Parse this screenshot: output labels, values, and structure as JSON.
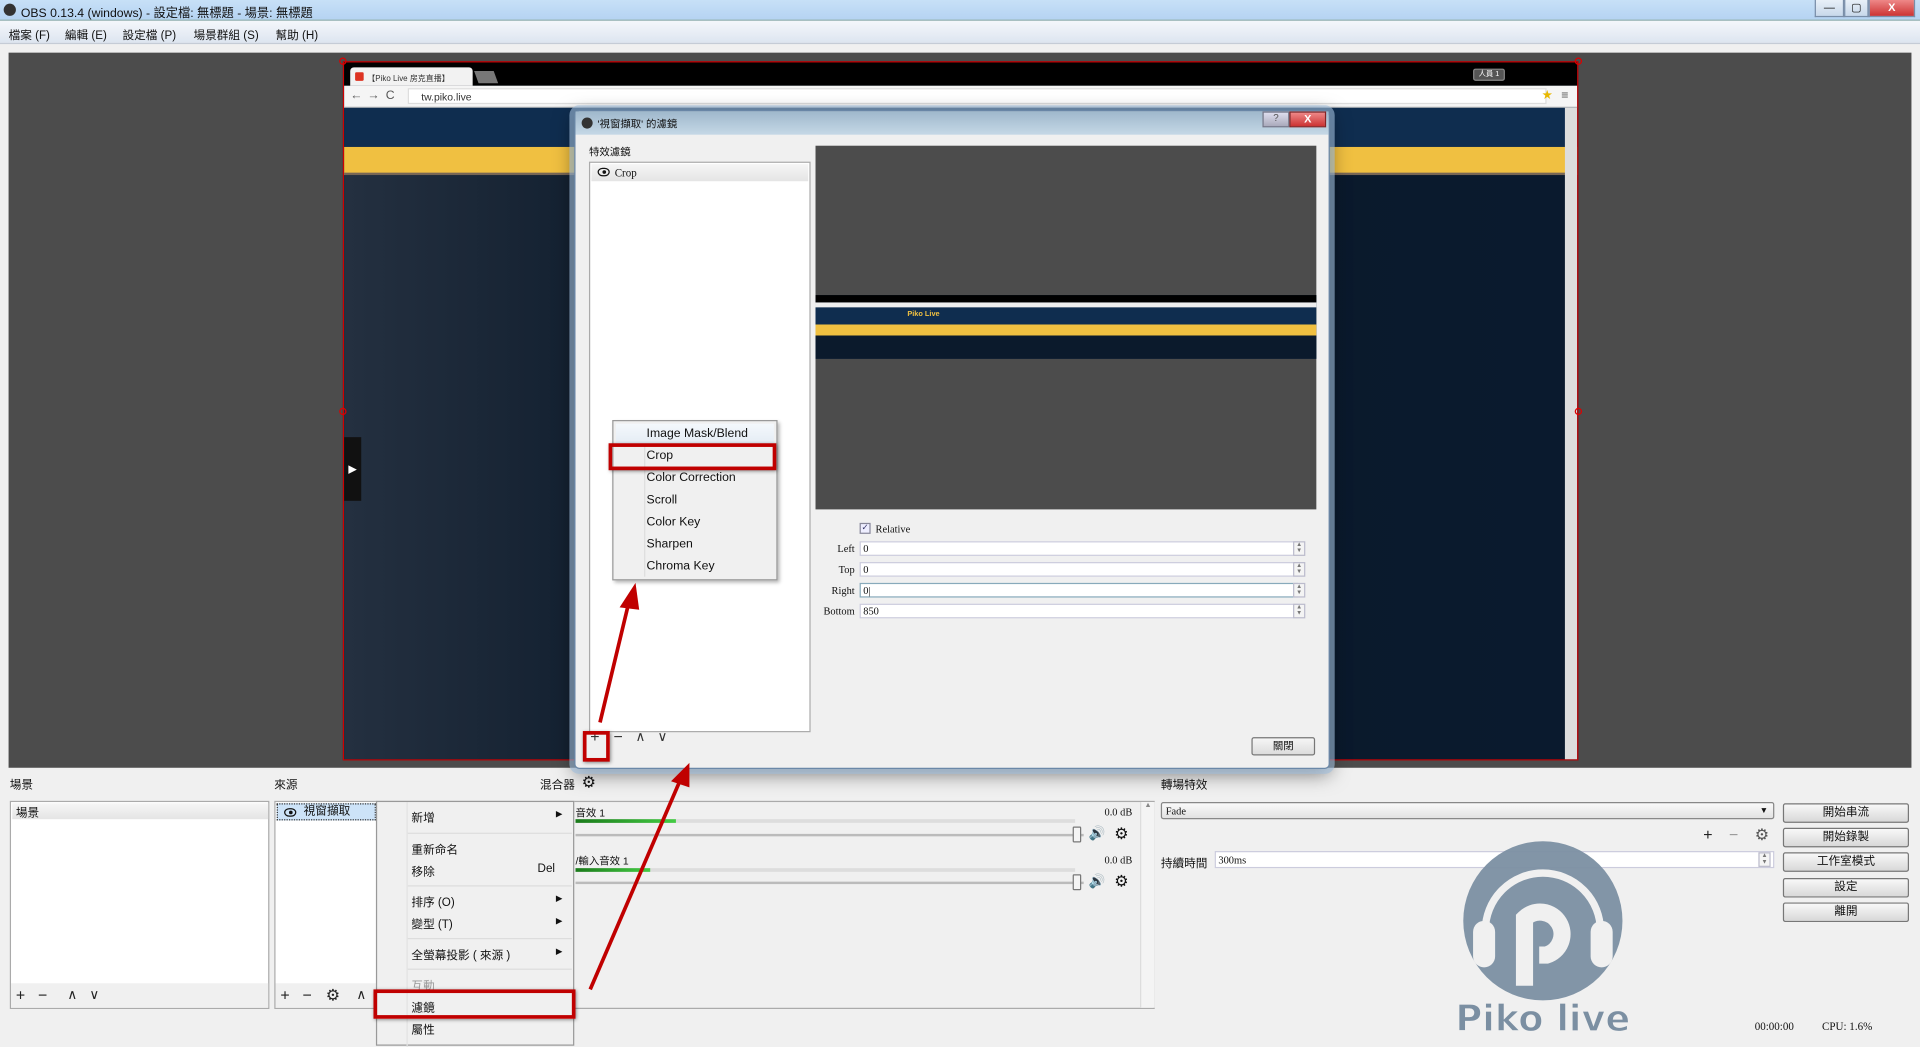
{
  "window": {
    "title": "OBS 0.13.4 (windows) - 設定檔: 無標題 - 場景: 無標題",
    "minimize": "—",
    "maximize": "▢",
    "close": "X"
  },
  "menubar": [
    "檔案 (F)",
    "編輯 (E)",
    "設定檔 (P)",
    "場景群組 (S)",
    "幫助 (H)"
  ],
  "browser": {
    "tab_title": "【Piko Live 房克直播】",
    "url": "tw.piko.live",
    "user_badge": "人員 1",
    "mini_logo": "Piko Live"
  },
  "filters_dialog": {
    "title": "'視窗擷取' 的濾鏡",
    "section_label": "特效濾鏡",
    "filters": [
      "Crop"
    ],
    "relative_label": "Relative",
    "relative_checked": true,
    "fields": [
      {
        "label": "Left",
        "value": "0"
      },
      {
        "label": "Top",
        "value": "0"
      },
      {
        "label": "Right",
        "value": "0|"
      },
      {
        "label": "Bottom",
        "value": "850"
      }
    ],
    "close_button": "關閉",
    "help": "?",
    "x": "X"
  },
  "add_filter_menu": [
    "Image Mask/Blend",
    "Crop",
    "Color Correction",
    "Scroll",
    "Color Key",
    "Sharpen",
    "Chroma Key"
  ],
  "add_filter_menu_highlighted": "Crop",
  "panels": {
    "scenes_label": "場景",
    "sources_label": "來源",
    "mixer_label": "混合器",
    "transitions_label": "轉場特效"
  },
  "scenes": [
    "場景"
  ],
  "sources": [
    "視窗擷取"
  ],
  "context_menu": {
    "items": [
      {
        "label": "新增",
        "submenu": true
      },
      {
        "label": "重新命名"
      },
      {
        "label": "移除",
        "shortcut": "Del"
      },
      {
        "label": "排序 (O)",
        "submenu": true
      },
      {
        "label": "變型 (T)",
        "submenu": true
      },
      {
        "label": "全螢幕投影 ( 來源 )",
        "submenu": true
      },
      {
        "label": "互動",
        "disabled": true
      },
      {
        "label": "濾鏡",
        "highlighted": true
      },
      {
        "label": "屬性"
      }
    ]
  },
  "mixer": [
    {
      "name": "音效 1",
      "db": "0.0 dB",
      "level_percent": 20,
      "volume_percent": 100
    },
    {
      "name": "/輸入音效 1",
      "db": "0.0 dB",
      "level_percent": 15,
      "volume_percent": 100
    }
  ],
  "transitions": {
    "selected": "Fade",
    "duration_label": "持續時間",
    "duration": "300ms"
  },
  "controls": [
    "開始串流",
    "開始錄製",
    "工作室模式",
    "設定",
    "離開"
  ],
  "status": {
    "time": "00:00:00",
    "cpu": "CPU: 1.6%"
  },
  "watermark": {
    "text": "Piko Live"
  },
  "colors": {
    "highlight_red": "#c00000",
    "titlebar": "#b5d3f2",
    "preview_bg": "#4c4c4c",
    "site_navy": "#0f2d4f",
    "site_yellow": "#f0c041"
  }
}
